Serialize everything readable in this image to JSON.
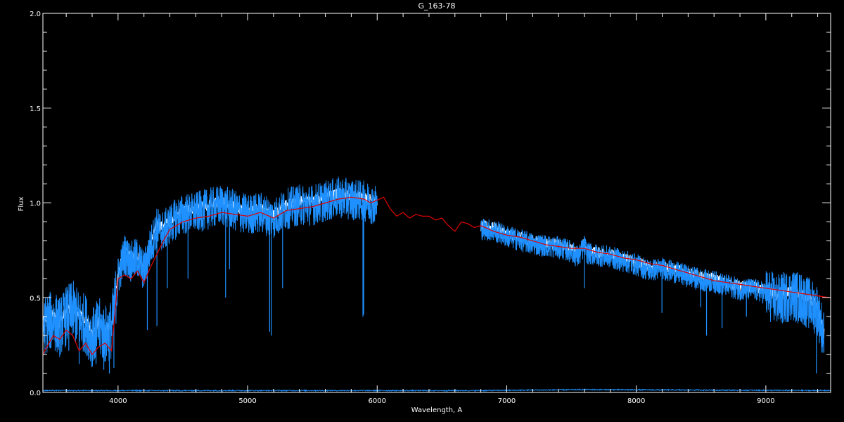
{
  "chart_data": {
    "type": "line",
    "title": "G_163-78",
    "xlabel": "Wavelength, A",
    "ylabel": "Flux",
    "xlim": [
      3420,
      9500
    ],
    "ylim": [
      0.0,
      2.0
    ],
    "xticks": [
      4000,
      5000,
      6000,
      7000,
      8000,
      9000
    ],
    "yticks": [
      0.0,
      0.5,
      1.0,
      1.5,
      2.0
    ],
    "ytick_labels": [
      "0.0",
      "0.5",
      "1.0",
      "1.5",
      "2.0"
    ],
    "background": "#000000",
    "grid": false,
    "legend": "none",
    "series": [
      {
        "role": "observed spectrum (blue)",
        "color": "#1e90ff",
        "segments": [
          {
            "x": [
              3420,
              3450,
              3500,
              3550,
              3600,
              3650,
              3700,
              3750,
              3800,
              3850,
              3900,
              3950,
              4000,
              4050,
              4100,
              4150,
              4200,
              4250,
              4300,
              4350,
              4400,
              4450,
              4500,
              4600,
              4700,
              4800,
              4900,
              5000,
              5100,
              5200,
              5300,
              5400,
              5500,
              5600,
              5700,
              5800,
              5900,
              6000
            ],
            "y": [
              0.36,
              0.38,
              0.4,
              0.36,
              0.42,
              0.45,
              0.4,
              0.38,
              0.3,
              0.36,
              0.32,
              0.35,
              0.62,
              0.74,
              0.7,
              0.72,
              0.65,
              0.78,
              0.88,
              0.86,
              0.9,
              0.93,
              0.95,
              0.96,
              0.98,
              1.0,
              0.97,
              0.95,
              0.96,
              0.93,
              0.98,
              1.0,
              1.0,
              1.02,
              1.04,
              1.03,
              1.02,
              1.0
            ]
          },
          {
            "x": [
              6800,
              6900,
              7000,
              7100,
              7200,
              7300,
              7400,
              7500,
              7550,
              7600,
              7620,
              7700,
              7800,
              7900,
              8000,
              8100,
              8200,
              8300,
              8400,
              8500,
              8600,
              8700,
              8800,
              8900,
              9000,
              9100,
              9200,
              9300,
              9400,
              9450
            ],
            "y": [
              0.87,
              0.86,
              0.83,
              0.81,
              0.79,
              0.78,
              0.77,
              0.75,
              0.72,
              0.78,
              0.74,
              0.73,
              0.72,
              0.7,
              0.68,
              0.65,
              0.66,
              0.64,
              0.62,
              0.6,
              0.59,
              0.57,
              0.55,
              0.55,
              0.53,
              0.5,
              0.53,
              0.5,
              0.45,
              0.3
            ]
          }
        ],
        "absorption_dips": [
          {
            "x": 3620,
            "y": 0.22
          },
          {
            "x": 3700,
            "y": 0.15
          },
          {
            "x": 3830,
            "y": 0.15
          },
          {
            "x": 3890,
            "y": 0.12
          },
          {
            "x": 3933,
            "y": 0.1
          },
          {
            "x": 3968,
            "y": 0.13
          },
          {
            "x": 4226,
            "y": 0.33
          },
          {
            "x": 4300,
            "y": 0.35
          },
          {
            "x": 4380,
            "y": 0.55
          },
          {
            "x": 4540,
            "y": 0.6
          },
          {
            "x": 4830,
            "y": 0.5
          },
          {
            "x": 4860,
            "y": 0.65
          },
          {
            "x": 5170,
            "y": 0.32
          },
          {
            "x": 5183,
            "y": 0.3
          },
          {
            "x": 5270,
            "y": 0.55
          },
          {
            "x": 5890,
            "y": 0.4
          },
          {
            "x": 5896,
            "y": 0.41
          },
          {
            "x": 7600,
            "y": 0.55
          },
          {
            "x": 8198,
            "y": 0.42
          },
          {
            "x": 8498,
            "y": 0.45
          },
          {
            "x": 8542,
            "y": 0.3
          },
          {
            "x": 8662,
            "y": 0.34
          },
          {
            "x": 8850,
            "y": 0.4
          },
          {
            "x": 9250,
            "y": 0.38
          },
          {
            "x": 9390,
            "y": 0.1
          }
        ]
      },
      {
        "role": "model spectrum (red)",
        "color": "#e10000",
        "x": [
          3420,
          3450,
          3500,
          3550,
          3600,
          3650,
          3700,
          3750,
          3800,
          3850,
          3900,
          3950,
          4000,
          4050,
          4100,
          4150,
          4200,
          4250,
          4300,
          4350,
          4400,
          4450,
          4500,
          4600,
          4700,
          4800,
          4900,
          5000,
          5100,
          5200,
          5300,
          5400,
          5500,
          5600,
          5700,
          5800,
          5900,
          5950,
          6050,
          6100,
          6150,
          6200,
          6250,
          6300,
          6350,
          6400,
          6450,
          6500,
          6550,
          6600,
          6650,
          6700,
          6750,
          6800,
          6900,
          7000,
          7100,
          7200,
          7300,
          7400,
          7500,
          7600,
          7700,
          7800,
          7900,
          8000,
          8100,
          8200,
          8300,
          8400,
          8500,
          8600,
          8700,
          8800,
          8900,
          9000,
          9100,
          9200,
          9300,
          9400,
          9500
        ],
        "y": [
          0.2,
          0.24,
          0.3,
          0.28,
          0.33,
          0.3,
          0.22,
          0.26,
          0.2,
          0.24,
          0.26,
          0.22,
          0.6,
          0.62,
          0.6,
          0.64,
          0.58,
          0.66,
          0.73,
          0.8,
          0.86,
          0.88,
          0.9,
          0.92,
          0.93,
          0.95,
          0.94,
          0.93,
          0.95,
          0.92,
          0.96,
          0.97,
          0.98,
          1.0,
          1.02,
          1.03,
          1.02,
          1.0,
          1.03,
          0.97,
          0.93,
          0.95,
          0.92,
          0.94,
          0.93,
          0.93,
          0.91,
          0.92,
          0.88,
          0.85,
          0.9,
          0.89,
          0.87,
          0.88,
          0.85,
          0.83,
          0.82,
          0.8,
          0.78,
          0.77,
          0.76,
          0.76,
          0.74,
          0.73,
          0.71,
          0.7,
          0.68,
          0.67,
          0.65,
          0.63,
          0.61,
          0.59,
          0.58,
          0.57,
          0.56,
          0.55,
          0.54,
          0.53,
          0.52,
          0.51,
          0.5
        ]
      },
      {
        "role": "error spectrum (near zero)",
        "color": "#1e90ff",
        "x": [
          3420,
          6000,
          6800,
          7600,
          9500
        ],
        "y": [
          0.01,
          0.01,
          0.01,
          0.015,
          0.01
        ]
      }
    ]
  }
}
